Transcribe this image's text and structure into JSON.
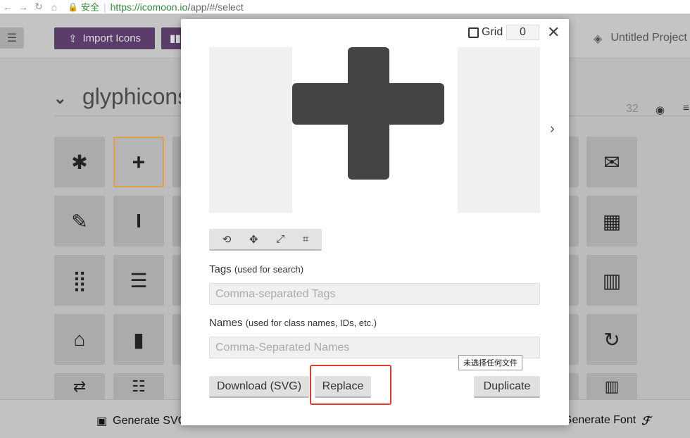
{
  "browser": {
    "secure_label": "安全",
    "url_host": "https://icomoon.io",
    "url_path": "/app/#/select"
  },
  "toolbar": {
    "import_label": "Import Icons",
    "project_label": "Untitled Project"
  },
  "icon_set": {
    "title": "glyphicons",
    "count": "32"
  },
  "footer": {
    "generate_svg": "Generate SVG",
    "generate_font": "Generate Font"
  },
  "modal": {
    "grid_label": "Grid",
    "grid_value": "0",
    "tags_label": "Tags",
    "tags_hint": "(used for search)",
    "tags_placeholder": "Comma-separated Tags",
    "names_label": "Names",
    "names_hint": "(used for class names, IDs, etc.)",
    "names_placeholder": "Comma-Separated Names",
    "download_label": "Download (SVG)",
    "replace_label": "Replace",
    "duplicate_label": "Duplicate",
    "file_tooltip": "未选择任何文件",
    "icon_color": "#444444",
    "highlight_color": "#e03c2e"
  }
}
